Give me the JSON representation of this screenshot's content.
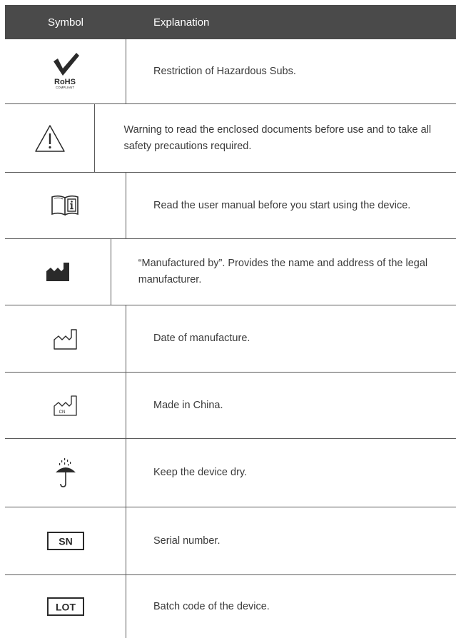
{
  "header": {
    "symbol": "Symbol",
    "explanation": "Explanation"
  },
  "rows": [
    {
      "icon": "rohs-compliant-icon",
      "icon_text": "RoHS",
      "icon_subtext": "COMPLIANT",
      "text": "Restriction of Hazardous Subs."
    },
    {
      "icon": "warning-triangle-icon",
      "text": "Warning to read the enclosed documents before use and to take all safety precautions required."
    },
    {
      "icon": "read-manual-icon",
      "text": "Read the user manual before you start using the device."
    },
    {
      "icon": "manufacturer-icon",
      "text": "“Manufactured by”. Provides the name and address of the legal manufacturer."
    },
    {
      "icon": "date-of-manufacture-icon",
      "text": "Date of manufacture."
    },
    {
      "icon": "country-of-manufacture-icon",
      "icon_text": "CN",
      "text": "Made in China."
    },
    {
      "icon": "keep-dry-icon",
      "text": "Keep the device dry."
    },
    {
      "icon": "serial-number-icon",
      "icon_text": "SN",
      "text": "Serial number."
    },
    {
      "icon": "batch-code-icon",
      "icon_text": "LOT",
      "text": "Batch code of the device."
    }
  ]
}
